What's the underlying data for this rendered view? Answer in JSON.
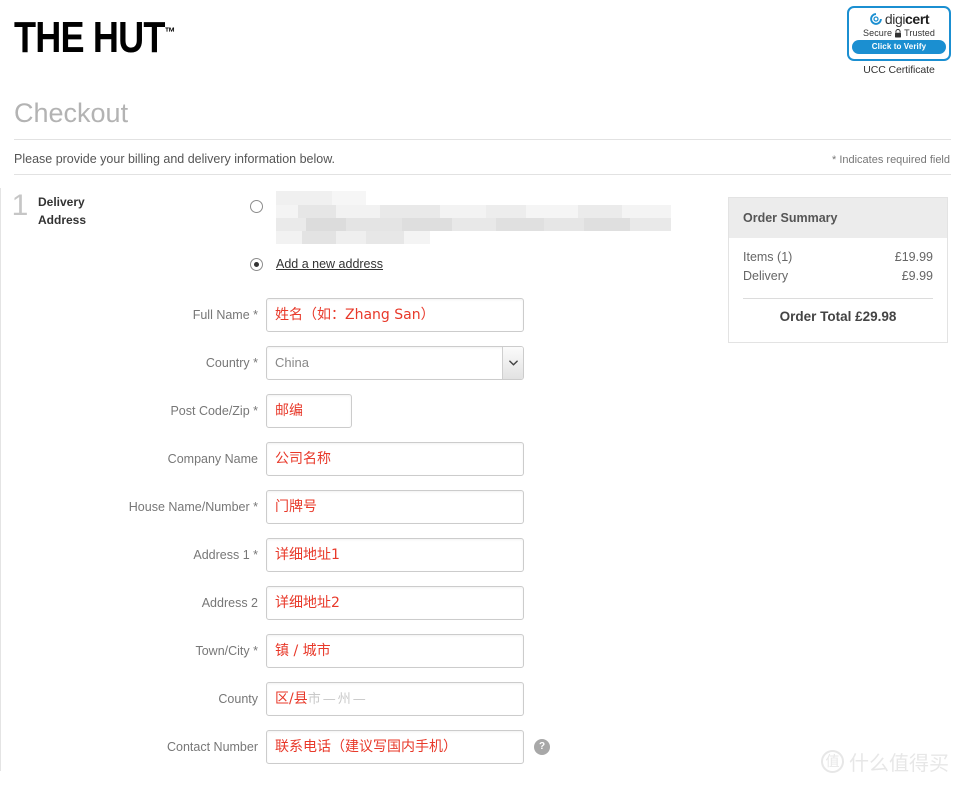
{
  "brand": {
    "logo_text": "THE HUT",
    "trademark": "™"
  },
  "trust_badge": {
    "name": "digicert",
    "word_di": "digi",
    "word_cert": "cert",
    "secure_text": "Secure",
    "trusted_text": "Trusted",
    "verify_button": "Click to Verify",
    "caption": "UCC Certificate",
    "accent_color": "#1b8fd1"
  },
  "page": {
    "title": "Checkout",
    "intro": "Please provide your billing and delivery information below.",
    "required_note": "* Indicates required field"
  },
  "step": {
    "number": "1",
    "title_line1": "Delivery",
    "title_line2": "Address"
  },
  "address_options": {
    "saved_address_redacted": "",
    "new_address_label": "Add a new address"
  },
  "form": {
    "country_value": "China",
    "county_ghost": "市—州—",
    "help_icon_label": "?",
    "fields": [
      {
        "label": "Full Name *",
        "value": "姓名（如：Zhang San）",
        "type": "text"
      },
      {
        "label": "Country *",
        "value": "China",
        "type": "select"
      },
      {
        "label": "Post Code/Zip *",
        "value": "邮编",
        "type": "text-narrow"
      },
      {
        "label": "Company Name",
        "value": "公司名称",
        "type": "text"
      },
      {
        "label": "House Name/Number *",
        "value": "门牌号",
        "type": "text"
      },
      {
        "label": "Address 1 *",
        "value": "详细地址1",
        "type": "text"
      },
      {
        "label": "Address 2",
        "value": "详细地址2",
        "type": "text"
      },
      {
        "label": "Town/City *",
        "value": "镇 / 城市",
        "type": "text"
      },
      {
        "label": "County",
        "value": "区/县",
        "type": "text-ghost"
      },
      {
        "label": "Contact Number",
        "value": "联系电话（建议写国内手机）",
        "type": "text-help"
      }
    ]
  },
  "order_summary": {
    "heading": "Order Summary",
    "lines": [
      {
        "label": "Items (1)",
        "amount": "£19.99"
      },
      {
        "label": "Delivery",
        "amount": "£9.99"
      }
    ],
    "total": "Order Total £29.98"
  },
  "watermark": {
    "mark": "值",
    "text": "什么值得买"
  }
}
